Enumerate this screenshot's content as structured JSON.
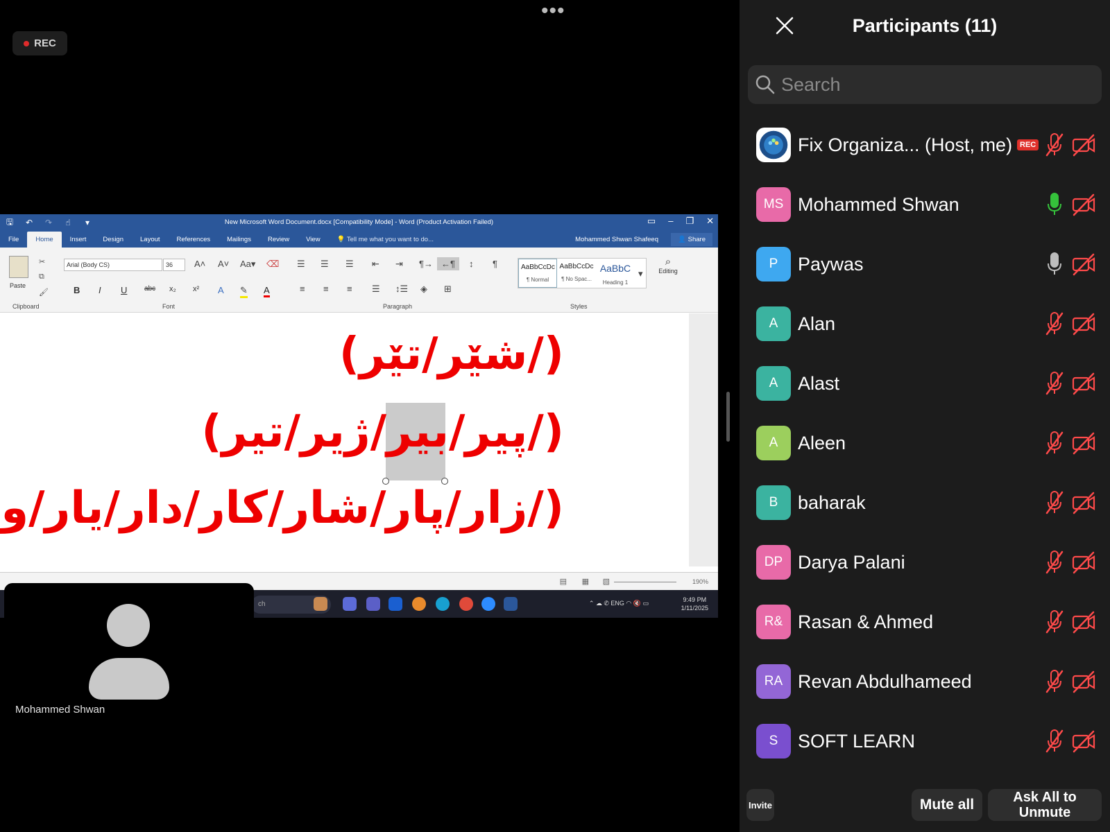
{
  "meeting": {
    "rec_label": "REC",
    "self_name": "Mohammed Shwan"
  },
  "word": {
    "doc_title": "New Microsoft Word Document.docx [Compatibility Mode] - Word (Product Activation Failed)",
    "tabs": [
      "File",
      "Home",
      "Insert",
      "Design",
      "Layout",
      "References",
      "Mailings",
      "Review",
      "View"
    ],
    "active_tab": "Home",
    "tell_me": "Tell me what you want to do...",
    "user": "Mohammed Shwan Shafeeq",
    "share_label": "Share",
    "paste_label": "Paste",
    "groups": [
      "Clipboard",
      "Font",
      "Paragraph",
      "Styles"
    ],
    "font_name": "Arial (Body CS)",
    "font_size": "36",
    "styles": [
      {
        "preview": "AaBbCcDc",
        "name": "¶ Normal"
      },
      {
        "preview": "AaBbCcDc",
        "name": "¶ No Spac..."
      },
      {
        "preview": "AaBbC",
        "name": "Heading 1"
      }
    ],
    "editing_label": "Editing",
    "lines": [
      "(/شێر/تێر)",
      "(/پیر/بیر/ژیر/تیر)",
      "(/زار/پار/شار/کار/دار/یار/وار)"
    ],
    "zoom": "190%",
    "taskbar_search": "ch",
    "tray_lang": "ENG",
    "clock_time": "9:49 PM",
    "clock_date": "1/11/2025"
  },
  "panel": {
    "title": "Participants (11)",
    "search_placeholder": "Search",
    "participants": [
      {
        "initials": "",
        "name": "Fix Organiza...  (Host, me)",
        "rec": "REC",
        "mic": "muted",
        "avatar_color": "#ffffff"
      },
      {
        "initials": "MS",
        "name": "Mohammed Shwan",
        "mic": "active",
        "avatar_color": "#e86aa8"
      },
      {
        "initials": "P",
        "name": "Paywas",
        "mic": "idle",
        "avatar_color": "#3ea8f0"
      },
      {
        "initials": "A",
        "name": "Alan",
        "mic": "muted",
        "avatar_color": "#3bb3a0"
      },
      {
        "initials": "A",
        "name": "Alast",
        "mic": "muted",
        "avatar_color": "#3bb3a0"
      },
      {
        "initials": "A",
        "name": "Aleen",
        "mic": "muted",
        "avatar_color": "#9ccf5d"
      },
      {
        "initials": "B",
        "name": "baharak",
        "mic": "muted",
        "avatar_color": "#3bb3a0"
      },
      {
        "initials": "DP",
        "name": "Darya Palani",
        "mic": "muted",
        "avatar_color": "#e86aa8"
      },
      {
        "initials": "R&",
        "name": "Rasan & Ahmed",
        "mic": "muted",
        "avatar_color": "#e86aa8"
      },
      {
        "initials": "RA",
        "name": "Revan Abdulhameed",
        "mic": "muted",
        "avatar_color": "#9366d6"
      },
      {
        "initials": "S",
        "name": "SOFT LEARN",
        "mic": "muted",
        "avatar_color": "#7a4fcf"
      }
    ],
    "invite_label": "Invite",
    "mute_all_label": "Mute all",
    "ask_unmute_label": "Ask All to Unmute"
  }
}
